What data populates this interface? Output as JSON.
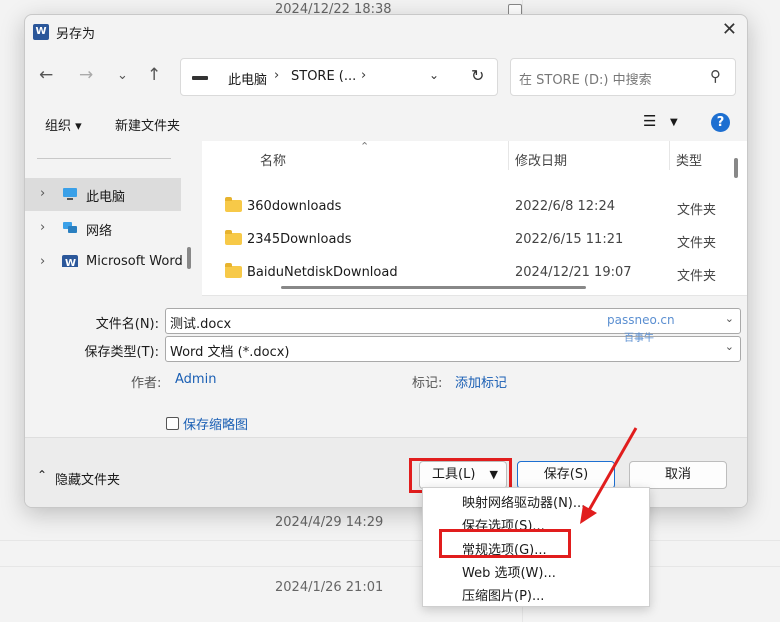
{
  "background": {
    "dates": [
      "2024/12/22 18:38",
      "2024/4/29 14:29",
      "2024/1/26 21:01"
    ]
  },
  "dialog": {
    "title": "另存为",
    "app_icon": "word-icon",
    "address": {
      "segments": [
        "此电脑",
        "STORE (..."
      ]
    },
    "search_placeholder": "在 STORE (D:) 中搜索",
    "toolbar": {
      "organize": "组织 ▾",
      "new_folder": "新建文件夹",
      "help": "?"
    },
    "nav": {
      "items": [
        {
          "label": "此电脑",
          "icon": "computer-icon",
          "selected": true
        },
        {
          "label": "网络",
          "icon": "network-icon",
          "selected": false
        },
        {
          "label": "Microsoft Word",
          "icon": "word-icon",
          "selected": false
        }
      ]
    },
    "columns": {
      "name": "名称",
      "date": "修改日期",
      "type": "类型"
    },
    "files": [
      {
        "name": "360downloads",
        "date": "2022/6/8 12:24",
        "type": "文件夹"
      },
      {
        "name": "2345Downloads",
        "date": "2022/6/15 11:21",
        "type": "文件夹"
      },
      {
        "name": "BaiduNetdiskDownload",
        "date": "2024/12/21 19:07",
        "type": "文件夹"
      }
    ],
    "form": {
      "filename_label": "文件名(N):",
      "filename_value": "测试.docx",
      "filetype_label": "保存类型(T):",
      "filetype_value": "Word 文档 (*.docx)",
      "author_label": "作者:",
      "author_value": "Admin",
      "tags_label": "标记:",
      "tags_value": "添加标记",
      "thumbnail_label": "保存缩略图"
    },
    "footer": {
      "hide_folders": "隐藏文件夹",
      "tools": "工具(L)",
      "save": "保存(S)",
      "cancel": "取消"
    }
  },
  "tools_menu": {
    "items": [
      "映射网络驱动器(N)...",
      "保存选项(S)...",
      "常规选项(G)...",
      "Web 选项(W)...",
      "压缩图片(P)..."
    ],
    "highlighted_index": 2
  },
  "watermark": {
    "line1": "passneo.cn",
    "line2": "百事牛"
  },
  "annotation_color": "#e11d1d"
}
